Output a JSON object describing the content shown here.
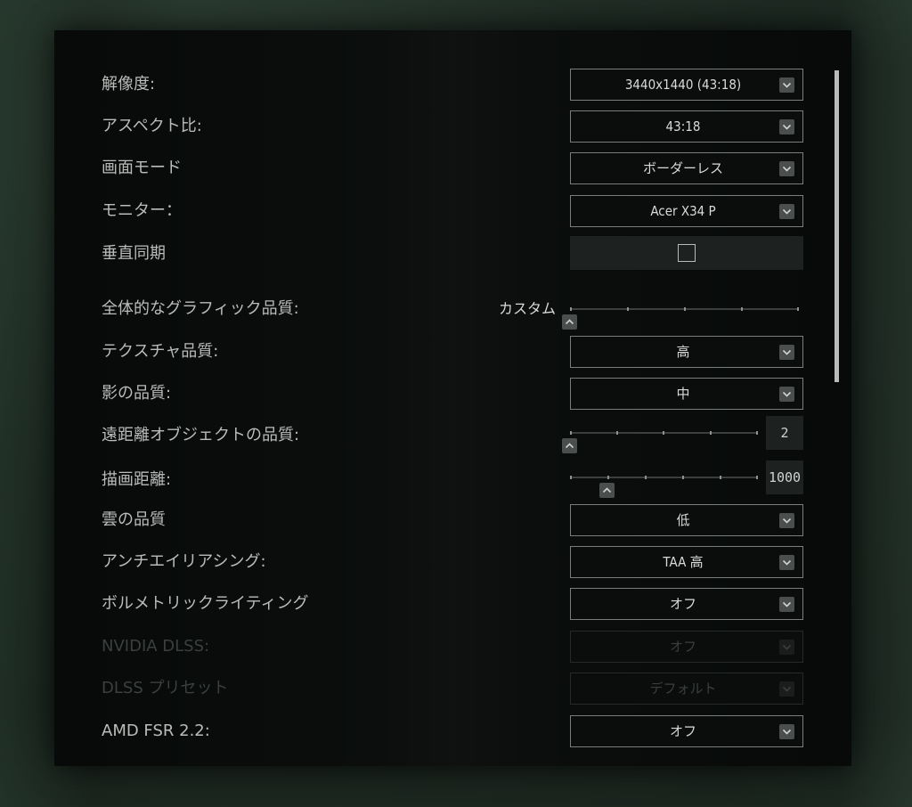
{
  "settings": [
    {
      "label": "解像度:",
      "type": "select",
      "value": "3440x1440 (43:18)"
    },
    {
      "label": "アスペクト比:",
      "type": "select",
      "value": "43:18"
    },
    {
      "label": "画面モード",
      "type": "select",
      "value": "ボーダーレス"
    },
    {
      "label": "モニター：",
      "type": "select",
      "value": "Acer X34 P"
    },
    {
      "label": "垂直同期",
      "type": "checkbox",
      "checked": false
    },
    {
      "label": "全体的なグラフィック品質:",
      "type": "slider",
      "caption": "カスタム",
      "level": 0
    },
    {
      "label": "テクスチャ品質:",
      "type": "select",
      "value": "高"
    },
    {
      "label": "影の品質:",
      "type": "select",
      "value": "中"
    },
    {
      "label": "遠距離オブジェクトの品質:",
      "type": "slider",
      "value": "2",
      "level": 0
    },
    {
      "label": "描画距離:",
      "type": "slider",
      "value": "1000",
      "level": 0.17
    },
    {
      "label": "雲の品質",
      "type": "select",
      "value": "低"
    },
    {
      "label": "アンチエイリアシング:",
      "type": "select",
      "value": "TAA 高"
    },
    {
      "label": "ボルメトリックライティング",
      "type": "select",
      "value": "オフ"
    },
    {
      "label": "NVIDIA DLSS:",
      "type": "select",
      "value": "オフ",
      "disabled": true
    },
    {
      "label": "DLSS プリセット",
      "type": "select",
      "value": "デフォルト",
      "disabled": true
    },
    {
      "label": "AMD FSR 2.2:",
      "type": "select",
      "value": "オフ"
    }
  ],
  "icons": {
    "dropdown": "chevron-down-icon",
    "slider_handle": "chevron-up-icon"
  },
  "colors": {
    "panel_bg": "#070a09",
    "text": "#b9bcb9",
    "disabled_text": "#3b403d",
    "control_bg": "#1d2220"
  }
}
